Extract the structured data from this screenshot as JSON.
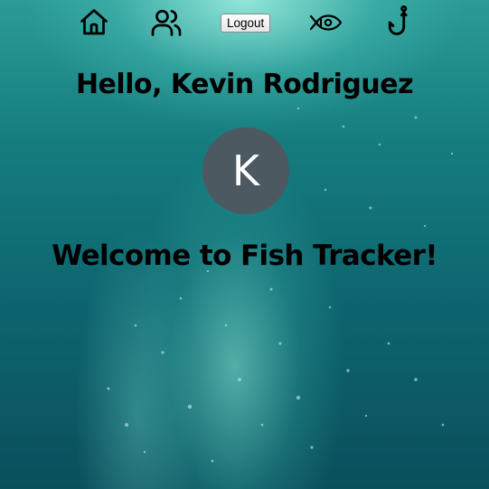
{
  "nav": {
    "items": [
      {
        "name": "home",
        "icon": "home-icon"
      },
      {
        "name": "people",
        "icon": "users-icon"
      },
      {
        "name": "fish",
        "icon": "fish-icon"
      },
      {
        "name": "fishing",
        "icon": "fishing-hook-icon"
      }
    ],
    "logout_label": "Logout"
  },
  "user": {
    "greeting": "Hello, Kevin Rodriguez",
    "avatar_initial": "K"
  },
  "main": {
    "welcome": "Welcome to Fish Tracker!"
  },
  "colors": {
    "avatar_bg": "#4d5960",
    "water_top": "#2c9b96",
    "water_bottom": "#0a4f5c"
  }
}
